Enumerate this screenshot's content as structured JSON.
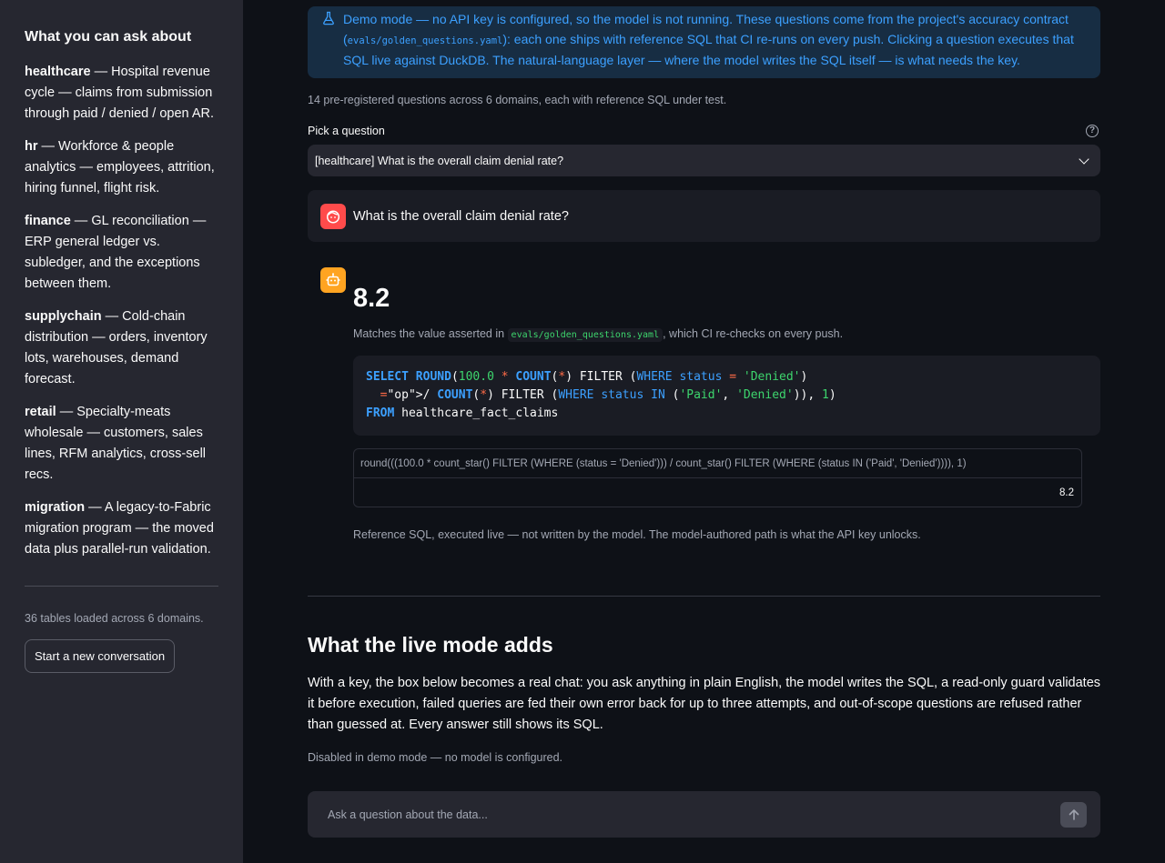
{
  "sidebar": {
    "heading": "What you can ask about",
    "domains": [
      {
        "name": "healthcare",
        "desc": " — Hospital revenue cycle — claims from submission through paid / denied / open AR."
      },
      {
        "name": "hr",
        "desc": " — Workforce & people analytics — employees, attrition, hiring funnel, flight risk."
      },
      {
        "name": "finance",
        "desc": " — GL reconciliation — ERP general ledger vs. subledger, and the exceptions between them."
      },
      {
        "name": "supplychain",
        "desc": " — Cold-chain distribution — orders, inventory lots, warehouses, demand forecast."
      },
      {
        "name": "retail",
        "desc": " — Specialty-meats wholesale — customers, sales lines, RFM analytics, cross-sell recs."
      },
      {
        "name": "migration",
        "desc": " — A legacy-to-Fabric migration program — the moved data plus parallel-run validation."
      }
    ],
    "tables_loaded": "36 tables loaded across 6 domains.",
    "new_conversation_label": "Start a new conversation"
  },
  "banner": {
    "text_1": "Demo mode — no API key is configured, so the model is not running. These questions come from the project's accuracy contract (",
    "code": "evals/golden_questions.yaml",
    "text_2": "): each one ships with reference SQL that CI re-runs on every push. Clicking a question executes that SQL live against DuckDB. The natural-language layer — where the model writes the SQL itself — is what needs the key."
  },
  "question_count": "14 pre-registered questions across 6 domains, each with reference SQL under test.",
  "picker": {
    "label": "Pick a question",
    "selected": "[healthcare]  What is the overall claim denial rate?"
  },
  "user_message": "What is the overall claim denial rate?",
  "answer": {
    "value": "8.2",
    "match_prefix": "Matches the value asserted in ",
    "match_code": "evals/golden_questions.yaml",
    "match_suffix": ", which CI re-checks on every push.",
    "sql_lines": [
      "SELECT ROUND(100.0 * COUNT(*) FILTER (WHERE status = 'Denied')",
      "  / COUNT(*) FILTER (WHERE status IN ('Paid', 'Denied')), 1)",
      "FROM healthcare_fact_claims"
    ],
    "table_header": "round(((100.0 * count_star() FILTER (WHERE (status = 'Denied'))) / count_star() FILTER (WHERE (status IN ('Paid', 'Denied')))), 1)",
    "table_value": "8.2",
    "reference_caption": "Reference SQL, executed live — not written by the model. The model-authored path is what the API key unlocks."
  },
  "live_mode": {
    "heading": "What the live mode adds",
    "paragraph": "With a key, the box below becomes a real chat: you ask anything in plain English, the model writes the SQL, a read-only guard validates it before execution, failed queries are fed their own error back for up to three attempts, and out-of-scope questions are refused rather than guessed at. Every answer still shows its SQL.",
    "disabled_caption": "Disabled in demo mode — no model is configured."
  },
  "chat_input": {
    "placeholder": "Ask a question about the data..."
  },
  "colors": {
    "accent_blue": "#3ca0ff",
    "user_avatar": "#ff4b4b",
    "bot_avatar": "#ffa421",
    "sidebar_bg": "#262730",
    "page_bg": "#0e1117"
  }
}
